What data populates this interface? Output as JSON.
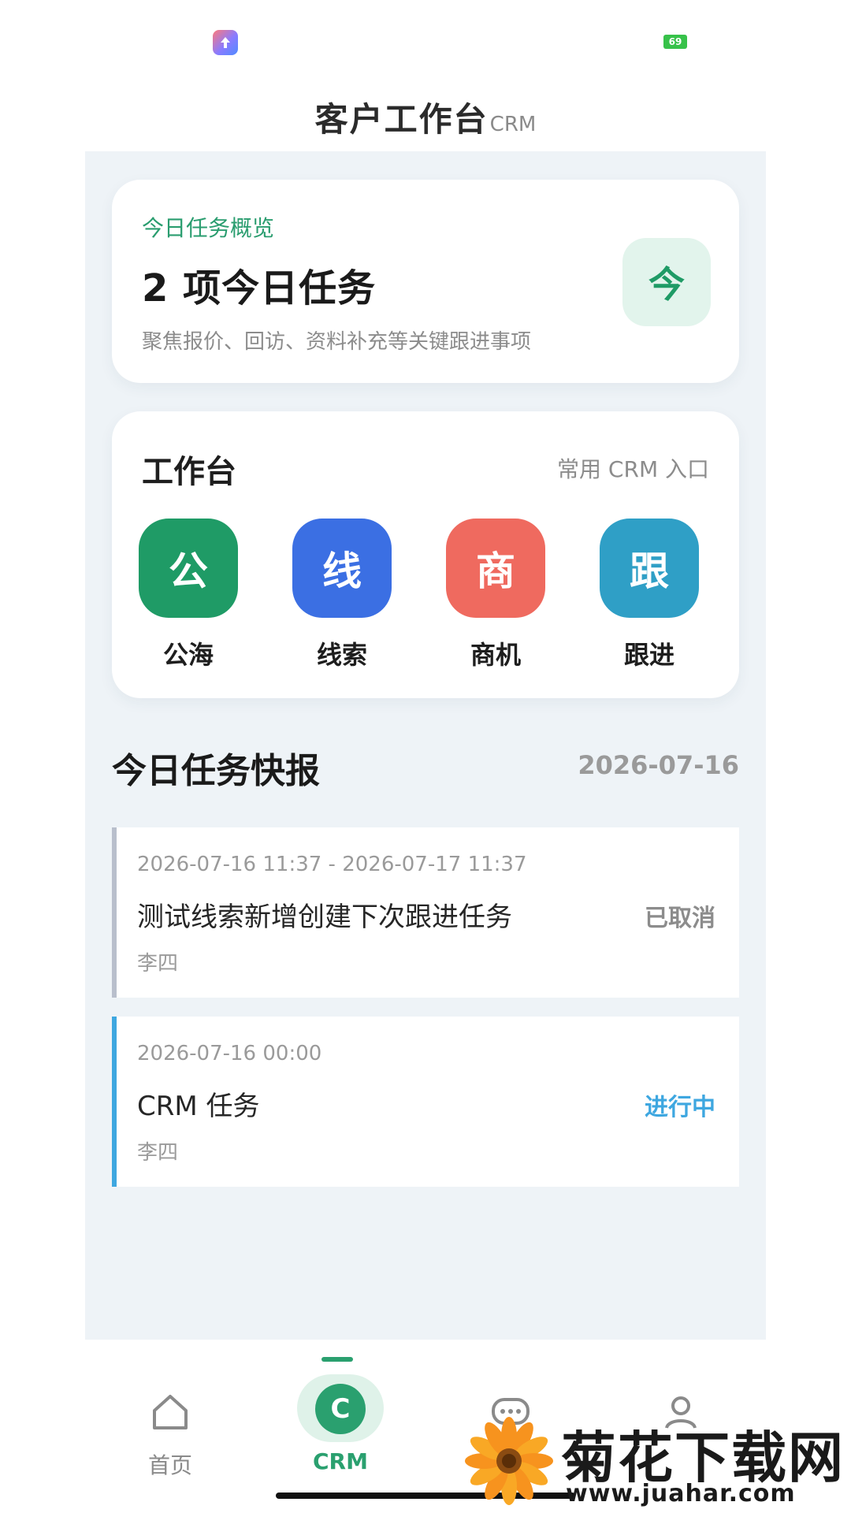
{
  "status_bar": {
    "battery": "69"
  },
  "header": {
    "title": "客户工作台",
    "subtitle": "CRM"
  },
  "overview": {
    "label": "今日任务概览",
    "count_text": "2 项今日任务",
    "description": "聚焦报价、回访、资料补充等关键跟进事项",
    "badge": "今"
  },
  "workbench": {
    "title": "工作台",
    "hint": "常用 CRM 入口",
    "items": [
      {
        "glyph": "公",
        "label": "公海",
        "color": "#1f9b66"
      },
      {
        "glyph": "线",
        "label": "线索",
        "color": "#3b6fe3"
      },
      {
        "glyph": "商",
        "label": "商机",
        "color": "#ef6a5f"
      },
      {
        "glyph": "跟",
        "label": "跟进",
        "color": "#2f9fc6"
      }
    ]
  },
  "tasks_section": {
    "title": "今日任务快报",
    "date": "2026-07-16"
  },
  "tasks": [
    {
      "time": "2026-07-16 11:37 - 2026-07-17 11:37",
      "name": "测试线索新增创建下次跟进任务",
      "status": "已取消",
      "owner": "李四",
      "bar_color": "#b9bfcc",
      "status_color": "#8c8c8c"
    },
    {
      "time": "2026-07-16 00:00",
      "name": "CRM 任务",
      "status": "进行中",
      "owner": "李四",
      "bar_color": "#3ea7e0",
      "status_color": "#3ea7e0"
    }
  ],
  "tabbar": {
    "tabs": [
      {
        "label": "首页",
        "icon": "home-icon"
      },
      {
        "label": "CRM",
        "icon": "crm-icon",
        "glyph": "C"
      },
      {
        "label": "",
        "icon": "message-icon"
      },
      {
        "label": "",
        "icon": "user-icon"
      }
    ]
  },
  "watermark": {
    "text": "菊花下载网",
    "url": "www.juahar.com"
  },
  "colors": {
    "accent": "#2aa06f",
    "background": "#eef3f7"
  }
}
